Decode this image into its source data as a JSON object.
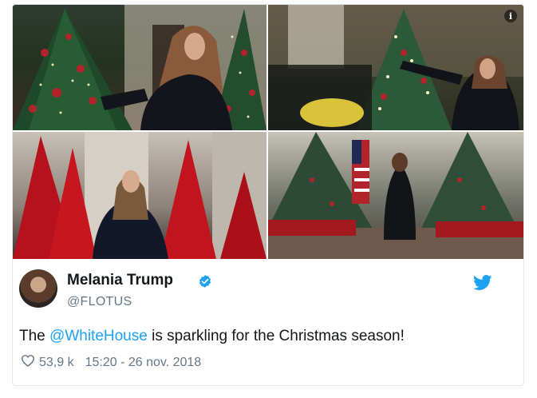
{
  "tweet": {
    "display_name": "Melania Trump",
    "handle": "@FLOTUS",
    "text_prefix": "The ",
    "mention": "@WhiteHouse",
    "text_suffix": " is sparkling for the Christmas season!",
    "likes": "53,9 k",
    "timestamp": "15:20 - 26 nov. 2018"
  },
  "media": {
    "info_icon": "i",
    "photos": [
      {
        "name": "photo-red-tree-hallway"
      },
      {
        "name": "photo-decorating-tree"
      },
      {
        "name": "photo-red-topiary-trees"
      },
      {
        "name": "photo-blue-room-trees"
      }
    ]
  },
  "icons": {
    "verified": "verified-badge-icon",
    "bird": "twitter-bird-icon",
    "heart": "heart-icon",
    "info": "info-icon"
  },
  "colors": {
    "accent": "#1da1f2",
    "text": "#14171a",
    "secondary": "#657786",
    "border": "#e1e8ed"
  }
}
